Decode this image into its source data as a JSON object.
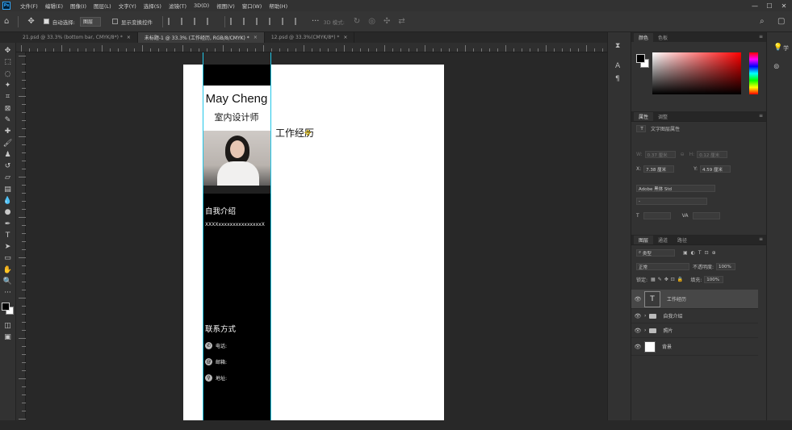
{
  "menubar": {
    "logo": "Ps",
    "items": [
      "文件(F)",
      "编辑(E)",
      "图像(I)",
      "图层(L)",
      "文字(Y)",
      "选择(S)",
      "滤镜(T)",
      "3D(D)",
      "视图(V)",
      "窗口(W)",
      "帮助(H)"
    ],
    "minimize": "—",
    "maximize": "☐",
    "close": "✕"
  },
  "options": {
    "auto_select_label": "自动选择:",
    "auto_select_value": "图层",
    "show_transform_label": "显示变换控件",
    "mode_3d": "3D 模式:"
  },
  "tabs": [
    {
      "label": "21.psd @ 33.3% (bottom bar, CMYK/8*) *",
      "close": "×"
    },
    {
      "label": "未标题-1 @ 33.3% (工作经历, RGB/8/CMYK) *",
      "close": "×"
    },
    {
      "label": "12.psd @ 33.3%(CMYK/8*) *",
      "close": "×"
    }
  ],
  "resume": {
    "name": "May Cheng",
    "role": "室内设计师",
    "intro_title": "自我介绍",
    "intro_text": "XXXXxxxxxxxxxxxxxxxX",
    "contact_title": "联系方式",
    "phone_label": "电话:",
    "email_label": "邮箱:",
    "address_label": "地址:",
    "work_title": "工作经历"
  },
  "color_panel": {
    "tab_color": "颜色",
    "tab_swatches": "色板"
  },
  "properties_panel": {
    "tab_properties": "属性",
    "tab_adjust": "调整",
    "heading": "文字图层属性",
    "w_label": "W:",
    "w_value": "0.37 厘米",
    "h_label": "H:",
    "h_value": "0.12 厘米",
    "x_label": "X:",
    "x_value": "7.38 厘米",
    "y_label": "Y:",
    "y_value": "4.59 厘米",
    "font_family": "Adobe 黑体 Std",
    "font_style": "-",
    "size_icon": "T",
    "va_icon": "VA"
  },
  "layers_panel": {
    "tab_layers": "图层",
    "tab_channels": "通道",
    "tab_paths": "路径",
    "filter_label": "类型",
    "blend_mode": "正常",
    "opacity_label": "不透明度:",
    "opacity_value": "100%",
    "lock_label": "锁定:",
    "fill_label": "填充:",
    "fill_value": "100%",
    "layers": [
      {
        "name": "工作经历",
        "type": "text"
      },
      {
        "name": "自我介绍",
        "type": "group"
      },
      {
        "name": "照片",
        "type": "group"
      },
      {
        "name": "背景",
        "type": "fill"
      }
    ]
  },
  "side_labels": {
    "learn": "学"
  }
}
